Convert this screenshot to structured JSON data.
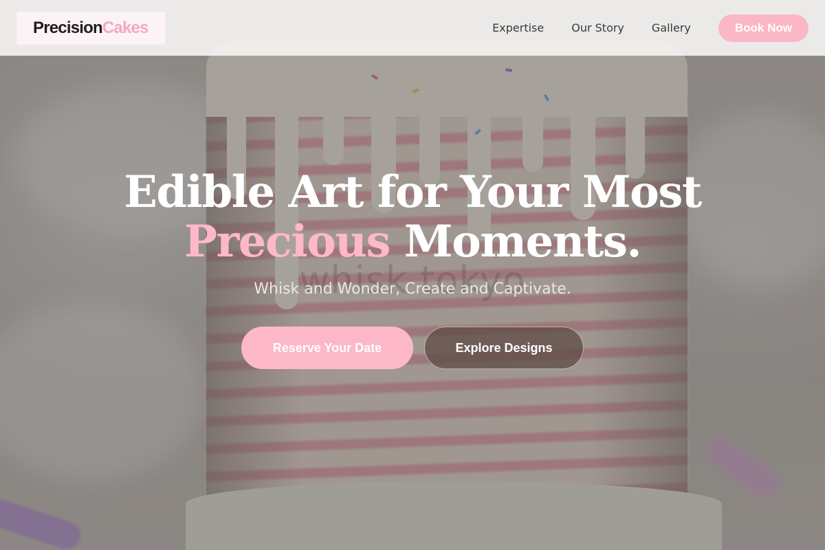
{
  "header": {
    "logo_part1": "Precision",
    "logo_part2": "Cakes",
    "nav": [
      "Expertise",
      "Our Story",
      "Gallery"
    ],
    "cta_label": "Book Now"
  },
  "hero": {
    "title_line1": "Edible Art for Your Most",
    "title_accent": "Precious",
    "title_rest": "Moments.",
    "subtitle": "Whisk and Wonder, Create and Captivate.",
    "primary_cta": "Reserve Your Date",
    "secondary_cta": "Explore Designs",
    "image_watermark": "whisk tokyo"
  },
  "colors": {
    "accent_pink": "#f5a9bd",
    "button_pink": "#fcb8c8",
    "logo_dark": "#1f1c22"
  }
}
